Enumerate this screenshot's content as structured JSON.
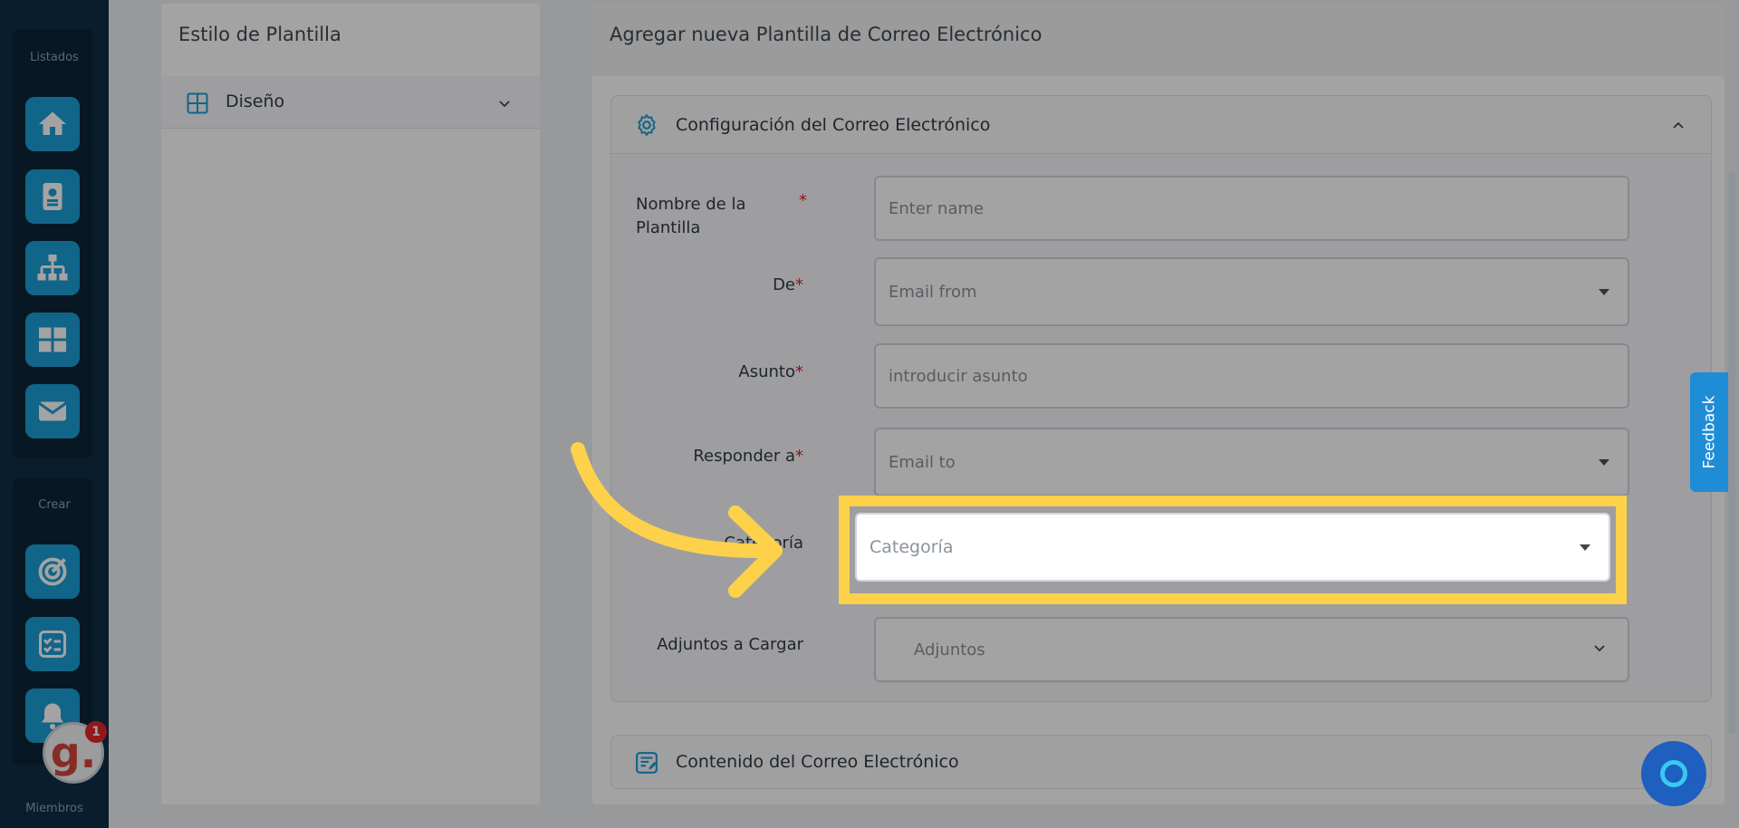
{
  "sidebar": {
    "section_lists": "Listados",
    "section_create": "Crear",
    "section_members": "Miembros",
    "list_buttons": [
      "home-icon",
      "contact-card-icon",
      "org-chart-icon",
      "grid-icon",
      "mail-icon"
    ],
    "create_buttons": [
      "target-icon",
      "checklist-icon",
      "bell-icon"
    ],
    "avatar_letter": "g.",
    "notification_count": "1"
  },
  "left_panel": {
    "title": "Estilo de Plantilla",
    "design_label": "Diseño"
  },
  "right_panel": {
    "title": "Agregar nueva Plantilla de Correo Electrónico",
    "config_section": "Configuración del Correo Electrónico",
    "content_section": "Contenido del Correo Electrónico",
    "fields": {
      "name_label": "Nombre de la Plantilla",
      "name_placeholder": "Enter name",
      "from_label": "De",
      "from_placeholder": "Email from",
      "subject_label": "Asunto",
      "subject_placeholder": "introducir asunto",
      "reply_label": "Responder a",
      "reply_placeholder": "Email to",
      "category_label": "Categoría",
      "category_placeholder": "Categoría",
      "attachments_label": "Adjuntos a Cargar",
      "attachments_placeholder": "Adjuntos"
    },
    "required_mark": "*"
  },
  "feedback_label": "Feedback",
  "colors": {
    "highlight": "#fdd24a",
    "accent": "#1c9fd6",
    "sidebar": "#0f2e45"
  }
}
